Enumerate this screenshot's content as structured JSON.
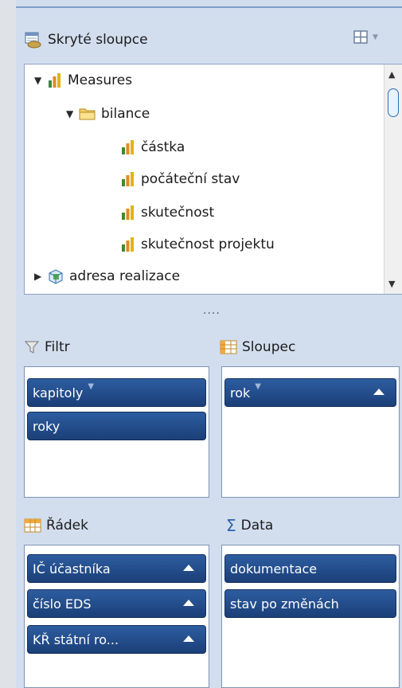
{
  "header": {
    "title": "Skryté sloupce",
    "layout_icon": "layout-grid-icon"
  },
  "tree": {
    "items": [
      {
        "label": "Measures",
        "toggle": "▼",
        "icon": "measure-bars-icon"
      },
      {
        "label": "bilance",
        "toggle": "▼",
        "icon": "folder-icon"
      },
      {
        "label": "částka",
        "icon": "measure-bars-icon"
      },
      {
        "label": "počáteční stav",
        "icon": "measure-bars-icon"
      },
      {
        "label": "skutečnost",
        "icon": "measure-bars-icon"
      },
      {
        "label": "skutečnost projektu",
        "icon": "measure-bars-icon"
      },
      {
        "label": "adresa realizace",
        "toggle": "▶",
        "icon": "dimension-cube-icon"
      }
    ]
  },
  "splitter": "....",
  "zones": {
    "filter": {
      "title": "Filtr",
      "icon": "funnel-icon",
      "chips": [
        "kapitoly",
        "roky"
      ]
    },
    "column": {
      "title": "Sloupec",
      "icon": "column-grid-icon",
      "chips": [
        "rok"
      ]
    },
    "row": {
      "title": "Řádek",
      "icon": "row-grid-icon",
      "chips": [
        "IČ účastníka",
        "číslo EDS",
        "KŘ státní ro..."
      ]
    },
    "data": {
      "title": "Data",
      "icon": "sigma-icon",
      "chips": [
        "dokumentace",
        "stav po změnách"
      ]
    }
  },
  "colors": {
    "chip": "#1f4a8a",
    "panel": "#d2deee",
    "border": "#7d93b3"
  }
}
